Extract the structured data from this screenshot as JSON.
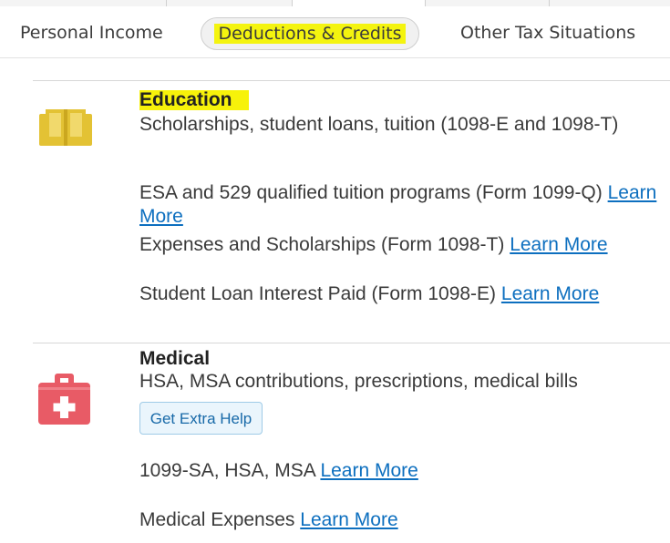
{
  "colors": {
    "highlight": "#f7f20a",
    "link": "#0d6fbf",
    "book_icon": "#e3c234",
    "medical_icon": "#e85b66"
  },
  "tabs": [
    {
      "label": "Personal Income"
    },
    {
      "label": "Deductions & Credits",
      "active": true
    },
    {
      "label": "Other Tax Situations"
    }
  ],
  "education": {
    "icon": "book-icon",
    "title": "Education",
    "description": "Scholarships, student loans, tuition (1098-E and 1098-T)",
    "items": [
      {
        "label": "ESA and 529 qualified tuition programs (Form 1099-Q)",
        "link": "Learn More"
      },
      {
        "label": "Expenses and Scholarships (Form 1098-T)",
        "link": "Learn More"
      },
      {
        "label": "Student Loan Interest Paid (Form 1098-E)",
        "link": "Learn More"
      }
    ]
  },
  "medical": {
    "icon": "medical-kit-icon",
    "title": "Medical",
    "description": "HSA, MSA contributions, prescriptions, medical bills",
    "help_button": "Get Extra Help",
    "items": [
      {
        "label": "1099-SA, HSA, MSA",
        "link": "Learn More"
      },
      {
        "label": "Medical Expenses",
        "link": "Learn More"
      }
    ]
  }
}
